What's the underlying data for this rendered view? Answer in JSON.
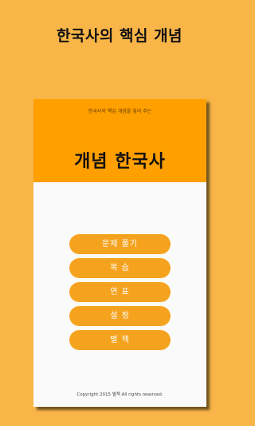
{
  "promo": {
    "headline": "한국사의 핵심 개념"
  },
  "app": {
    "tagline": "한국사의 핵심 개념을 짚어 주는",
    "title": "개념 한국사",
    "menu": [
      {
        "label": "문제 풀기"
      },
      {
        "label": "복 습"
      },
      {
        "label": "연 표"
      },
      {
        "label": "설 정"
      },
      {
        "label": "별 책"
      }
    ],
    "copyright": "Copyright 2015 별책 All rights reserved."
  },
  "colors": {
    "background": "#F9B548",
    "header": "#FF9F00",
    "button": "#F5A31F",
    "screen": "#FAFAFA"
  }
}
